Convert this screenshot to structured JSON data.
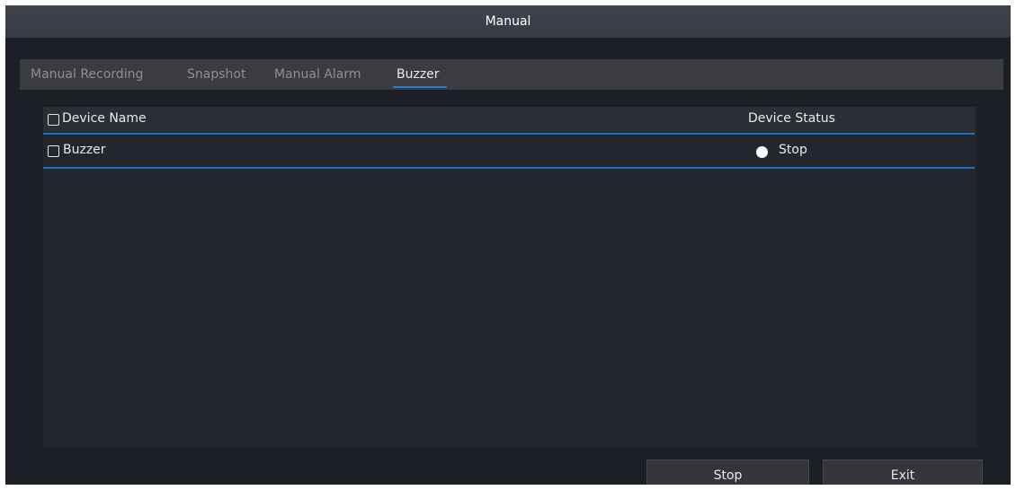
{
  "window": {
    "title": "Manual"
  },
  "tabs": [
    {
      "label": "Manual Recording",
      "active": false
    },
    {
      "label": "Snapshot",
      "active": false
    },
    {
      "label": "Manual Alarm",
      "active": false
    },
    {
      "label": "Buzzer",
      "active": true
    }
  ],
  "table": {
    "columns": {
      "name": "Device Name",
      "status": "Device Status"
    },
    "rows": [
      {
        "name": "Buzzer",
        "status": "Stop",
        "status_color": "#ffffff",
        "checked": false
      }
    ]
  },
  "buttons": {
    "stop": "Stop",
    "exit": "Exit"
  },
  "colors": {
    "accent": "#1f7bd6",
    "background": "#1d1f26"
  }
}
